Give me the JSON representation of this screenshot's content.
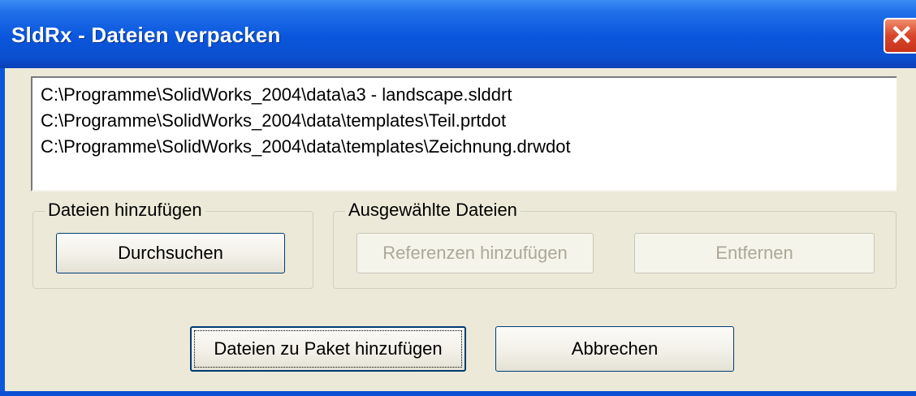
{
  "window": {
    "title": "SldRx - Dateien verpacken"
  },
  "file_list": [
    "C:\\Programme\\SolidWorks_2004\\data\\a3 - landscape.slddrt",
    "C:\\Programme\\SolidWorks_2004\\data\\templates\\Teil.prtdot",
    "C:\\Programme\\SolidWorks_2004\\data\\templates\\Zeichnung.drwdot"
  ],
  "add_files_group": {
    "legend": "Dateien hinzufügen",
    "browse_label": "Durchsuchen"
  },
  "selected_files_group": {
    "legend": "Ausgewählte Dateien",
    "add_references_label": "Referenzen hinzufügen",
    "remove_label": "Entfernen"
  },
  "footer": {
    "add_to_package_label": "Dateien zu Paket hinzufügen",
    "cancel_label": "Abbrechen"
  },
  "icons": {
    "close": "close-icon"
  }
}
